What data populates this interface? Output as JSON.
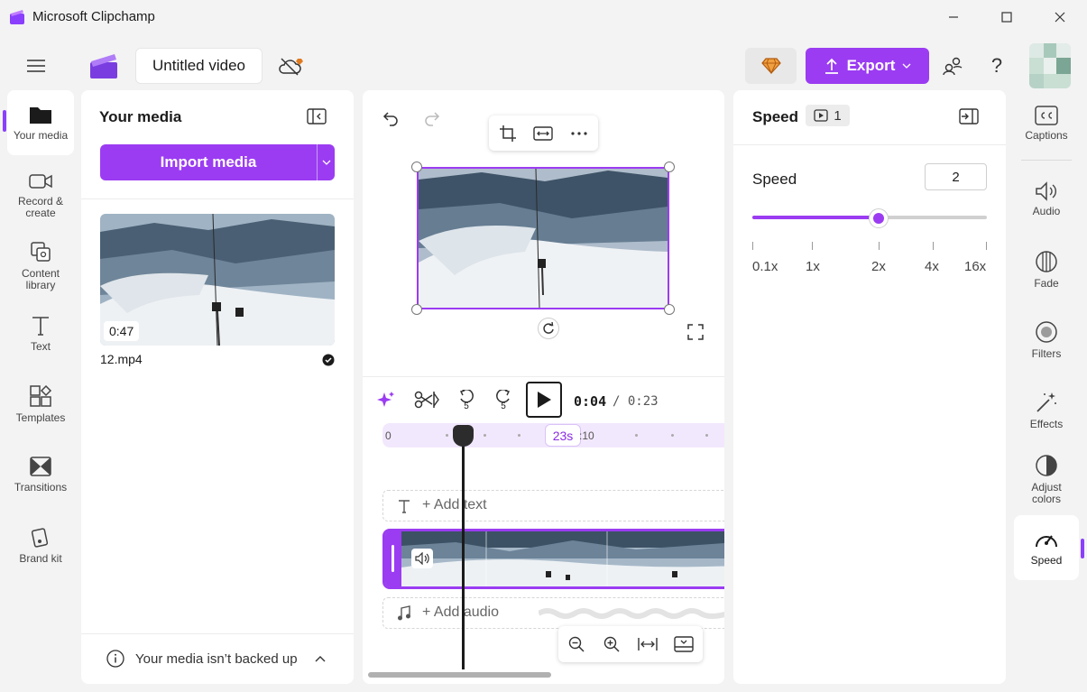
{
  "window": {
    "title": "Microsoft Clipchamp",
    "minimize_icon": "minimize-icon",
    "maximize_icon": "maximize-icon",
    "close_icon": "close-icon"
  },
  "toolbar": {
    "project_name": "Untitled video",
    "export_label": "Export"
  },
  "left_rail": {
    "items": [
      {
        "label": "Your media",
        "icon": "folder-icon",
        "active": true
      },
      {
        "label": "Record & create",
        "icon": "camera-icon"
      },
      {
        "label": "Content library",
        "icon": "library-icon"
      },
      {
        "label": "Text",
        "icon": "text-icon"
      },
      {
        "label": "Templates",
        "icon": "templates-icon"
      },
      {
        "label": "Transitions",
        "icon": "transitions-icon"
      },
      {
        "label": "Brand kit",
        "icon": "brand-kit-icon"
      }
    ]
  },
  "media_panel": {
    "title": "Your media",
    "import_label": "Import media",
    "item": {
      "duration": "0:47",
      "file_name": "12.mp4"
    },
    "backup_notice": "Your media isn’t backed up"
  },
  "timeline": {
    "current_time": "0:04",
    "total_time": "/ 0:23",
    "skip_back_label": "5",
    "skip_forward_label": "5",
    "ruler_start": "0",
    "ruler_badge": "23s",
    "ruler_mark": ":10",
    "add_text": "+ Add text",
    "add_audio": "+ Add audio"
  },
  "speed_panel": {
    "title": "Speed",
    "clip_count": "1",
    "speed_label": "Speed",
    "speed_value": "2",
    "slider_fraction": 0.54,
    "tick_labels": [
      "0.1x",
      "1x",
      "2x",
      "4x",
      "16x"
    ]
  },
  "right_rail": {
    "items": [
      {
        "label": "Captions",
        "icon": "captions-icon"
      },
      {
        "label": "Audio",
        "icon": "speaker-icon"
      },
      {
        "label": "Fade",
        "icon": "fade-icon"
      },
      {
        "label": "Filters",
        "icon": "filters-icon"
      },
      {
        "label": "Effects",
        "icon": "effects-icon"
      },
      {
        "label": "Adjust colors",
        "icon": "adjust-colors-icon"
      },
      {
        "label": "Speed",
        "icon": "speed-icon",
        "active": true
      }
    ]
  },
  "colors": {
    "accent": "#9b3cf2",
    "background": "#f3f3f3"
  }
}
